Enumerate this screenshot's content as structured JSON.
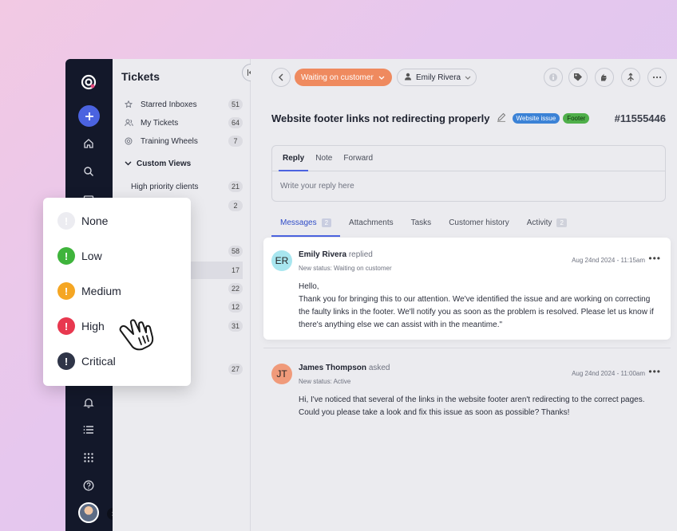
{
  "sidebar": {
    "title": "Tickets",
    "items": [
      {
        "label": "Starred Inboxes",
        "count": "51",
        "icon": "star-icon"
      },
      {
        "label": "My Tickets",
        "count": "64",
        "icon": "users-icon"
      },
      {
        "label": "Training Wheels",
        "count": "7",
        "icon": "life-ring-icon"
      }
    ],
    "section": "Custom Views",
    "views": [
      {
        "label": "High priority clients",
        "count": "21"
      },
      {
        "label": "",
        "count": "2"
      },
      {
        "label": "",
        "count": "58"
      },
      {
        "label": "",
        "count": "17"
      },
      {
        "label": "",
        "count": "22"
      },
      {
        "label": "",
        "count": "12"
      },
      {
        "label": "",
        "count": "31"
      },
      {
        "label": "",
        "count": "27"
      }
    ]
  },
  "topbar": {
    "status": "Waiting on customer",
    "assignee": "Emily Rivera"
  },
  "ticket": {
    "title": "Website footer links not redirecting properly",
    "tags": [
      "Website issue",
      "Footer"
    ],
    "id": "#11555446"
  },
  "composer": {
    "tabs": [
      "Reply",
      "Note",
      "Forward"
    ],
    "placeholder": "Write your reply here"
  },
  "message_tabs": [
    {
      "label": "Messages",
      "count": "2"
    },
    {
      "label": "Attachments",
      "count": ""
    },
    {
      "label": "Tasks",
      "count": ""
    },
    {
      "label": "Customer history",
      "count": ""
    },
    {
      "label": "Activity",
      "count": "2"
    }
  ],
  "messages": [
    {
      "initials": "ER",
      "name": "Emily Rivera",
      "verb": "replied",
      "status": "New status: Waiting on customer",
      "time": "Aug 24nd 2024 - 11:15am",
      "lines": [
        "Hello,",
        "Thank you for bringing this to our attention. We've identified the issue and are working on correcting the faulty links in the footer. We'll notify you as soon as the problem is resolved. Please let us know if there's anything else we can assist with in the meantime.\""
      ]
    },
    {
      "initials": "JT",
      "name": "James Thompson",
      "verb": "asked",
      "status": "New status: Active",
      "time": "Aug 24nd 2024 - 11:00am",
      "lines": [
        "Hi, I've noticed that several of the links in the website footer aren't redirecting to the correct pages. Could you please take a look and fix this issue as soon as possible? Thanks!"
      ]
    }
  ],
  "priority_menu": [
    {
      "label": "None",
      "color": "#e8e8ee"
    },
    {
      "label": "Low",
      "color": "#3fb43c"
    },
    {
      "label": "Medium",
      "color": "#f5a623"
    },
    {
      "label": "High",
      "color": "#e8384f"
    },
    {
      "label": "Critical",
      "color": "#2f3548"
    }
  ]
}
